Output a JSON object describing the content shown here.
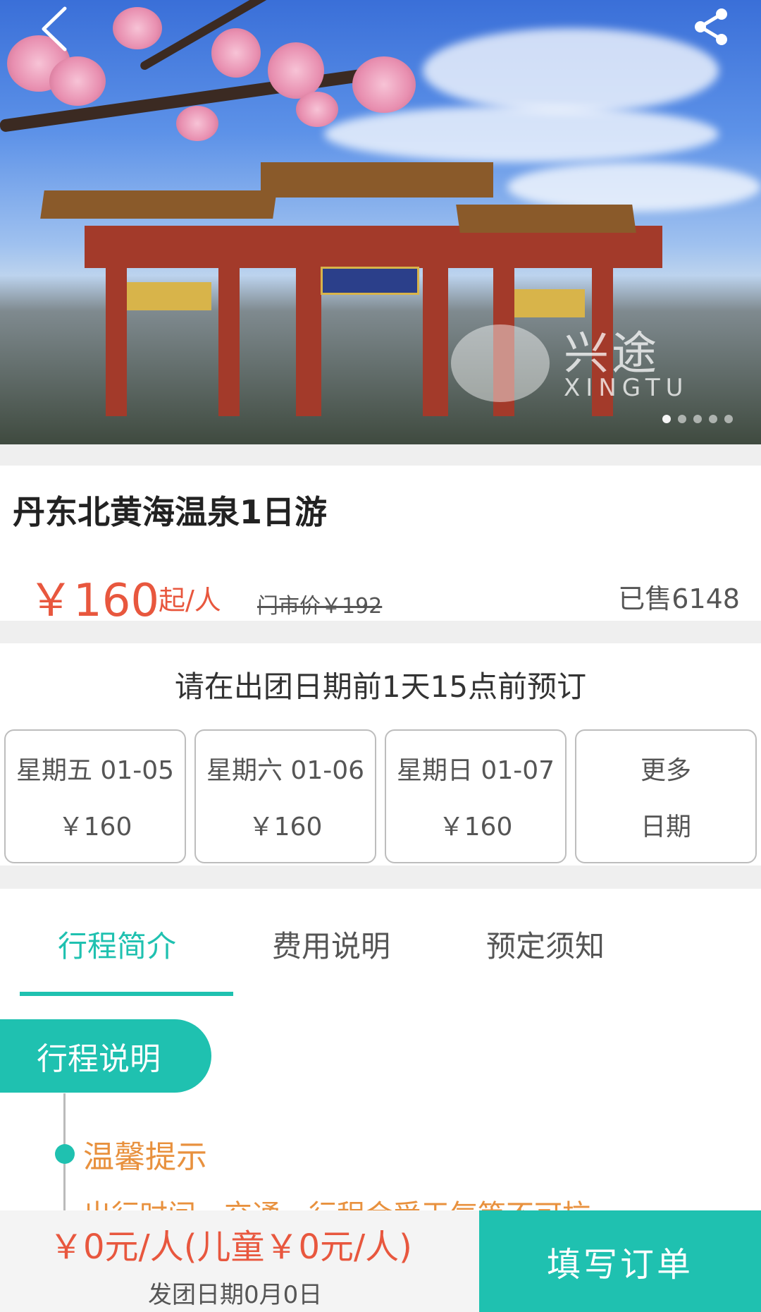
{
  "hero": {
    "watermark_cn": "兴途",
    "watermark_en": "XINGTU",
    "slide_count": 5,
    "active_slide": 0
  },
  "product": {
    "title": "丹东北黄海温泉1日游",
    "price": "￥160",
    "price_unit": "起/人",
    "original_price": "门市价￥192",
    "sold": "已售6148"
  },
  "booking": {
    "note": "请在出团日期前1天15点前预订",
    "dates": [
      {
        "day": "星期五 01-05",
        "price": "￥160"
      },
      {
        "day": "星期六 01-06",
        "price": "￥160"
      },
      {
        "day": "星期日 01-07",
        "price": "￥160"
      },
      {
        "day": "更多",
        "price": "日期"
      }
    ]
  },
  "tabs": [
    {
      "label": "行程简介"
    },
    {
      "label": "费用说明"
    },
    {
      "label": "预定须知"
    }
  ],
  "itinerary": {
    "section_label": "行程说明",
    "tip_title": "温馨提示",
    "tip_text": "出行时间、交通、行程会受天气等不可抗"
  },
  "bottom_bar": {
    "price": "￥0元/人(儿童￥0元/人)",
    "date": "发团日期0月0日",
    "button": "填写订单"
  },
  "colors": {
    "accent": "#1fc1b0",
    "price": "#e8573e",
    "tip": "#e8913e"
  }
}
